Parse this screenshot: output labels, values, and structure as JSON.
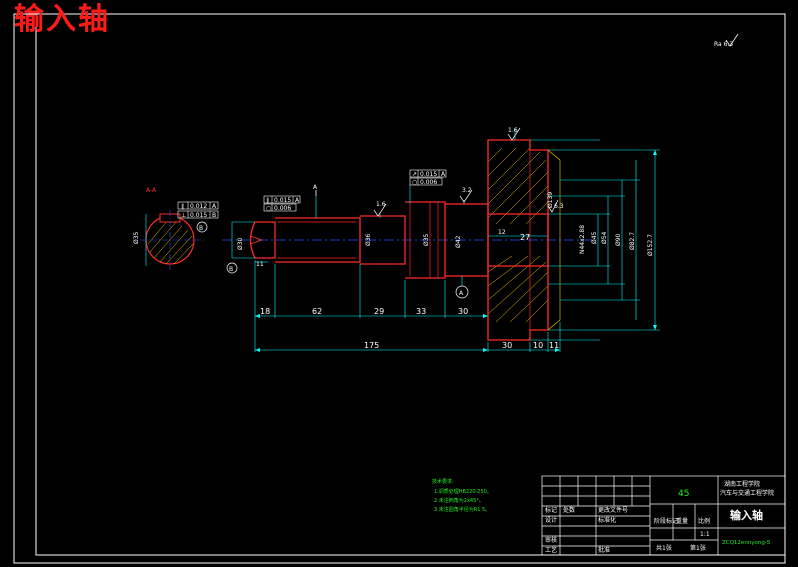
{
  "title": "输入轴",
  "roughness_note": "Ra 6.3",
  "section_label": "A-A",
  "section_callout": "A",
  "datum_labels": {
    "A": "A",
    "B": "B"
  },
  "tolerance_frames": {
    "tf1": {
      "sym": "∥",
      "val": "0.012",
      "ref": "A"
    },
    "tf2": {
      "sym": "⊥",
      "val": "0.015",
      "ref": "B"
    },
    "tf3": {
      "sym": "∥",
      "val": "0.015",
      "ref": "A"
    },
    "tf4": {
      "sym": "○",
      "val": "0.006",
      "ref": ""
    },
    "tf5": {
      "sym": "↗",
      "val": "0.015",
      "ref": "A"
    },
    "tf6": {
      "sym": "○",
      "val": "0.006",
      "ref": ""
    }
  },
  "roughness_marks": {
    "r1": "1.6",
    "r2": "3.2",
    "r3": "1.6",
    "r4": "6.3"
  },
  "diameter_labels": {
    "d1": "Ø35",
    "d2": "Ø30",
    "d3": "Ø36",
    "d4": "Ø35",
    "d5": "Ø42",
    "d6": "Ø45",
    "d7": "Ø54",
    "d8": "Ø90",
    "d9": "Ø139",
    "d10": "Ø82.7",
    "d11": "Ø152.7"
  },
  "dimensions": {
    "h1": "18",
    "h2": "62",
    "h3": "29",
    "h4": "33",
    "h5": "30",
    "total": "175",
    "b1": "30",
    "b2": "10",
    "b3": "11",
    "bore1": "12",
    "bore2": "27",
    "keyway": "11",
    "spline": "N44x2.88"
  },
  "notes": {
    "heading": "技术要求:",
    "items": [
      "1.调质处理HB220-250。",
      "2.未注倒角为2x45°。",
      "3.未注圆角半径为R1.5。"
    ]
  },
  "title_block": {
    "material": "45",
    "part_name": "输入轴",
    "school": "湖南工程学院",
    "dept": "汽车与交通工程学院",
    "drawing_no": "ZCQ12ennyong-5",
    "labels": {
      "designed": "设计",
      "checked": "审核",
      "process": "工艺",
      "mark": "标记",
      "count": "处数",
      "zone": "分区",
      "change": "更改文件号",
      "sign": "签名",
      "date": "年月日",
      "standard": "标准化",
      "approve": "批准",
      "stage": "阶段标记",
      "weight": "重量",
      "scale": "比例",
      "scale_val": "1:1",
      "sheets": "共1张",
      "sheet": "第1张"
    }
  },
  "colors": {
    "outline": "#ffffff",
    "part": "#ff2a2a",
    "dimension": "#00ffff",
    "centerline": "#2255ff",
    "hatch": "#ffcc00",
    "notes": "#22ee22"
  }
}
